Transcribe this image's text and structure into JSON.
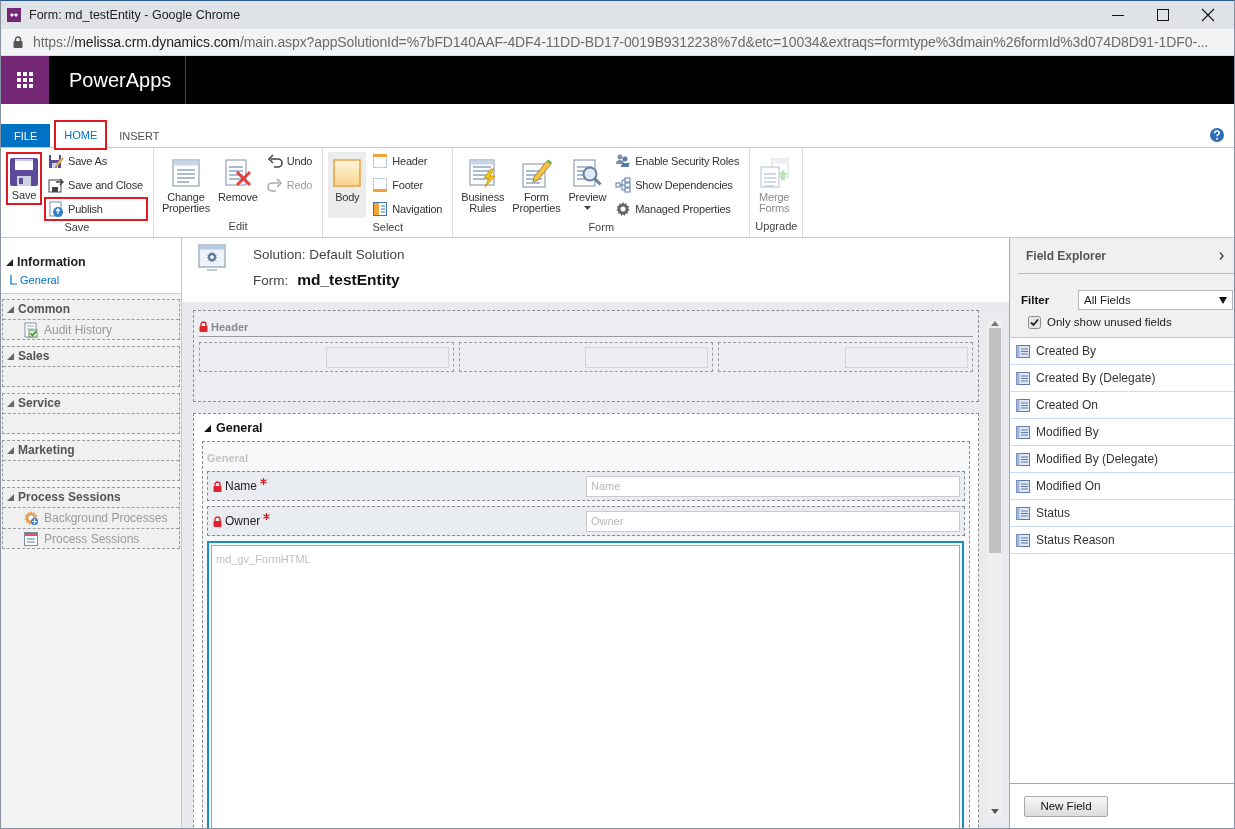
{
  "window": {
    "title": "Form: md_testEntity - Google Chrome"
  },
  "address_bar": {
    "scheme": "https://",
    "host": "melissa.crm.dynamics.com",
    "path": "/main.aspx?appSolutionId=%7bFD140AAF-4DF4-11DD-BD17-0019B9312238%7d&etc=10034&extraqs=formtype%3dmain%26formId%3d074D8D91-1DF0-..."
  },
  "app_bar": {
    "title": "PowerApps"
  },
  "ribbon": {
    "tabs": [
      {
        "label": "FILE",
        "kind": "file",
        "selected": false,
        "highlighted": false
      },
      {
        "label": "HOME",
        "kind": "tab",
        "selected": true,
        "highlighted": true
      },
      {
        "label": "INSERT",
        "kind": "tab",
        "selected": false,
        "highlighted": false
      }
    ],
    "groups": [
      {
        "label": "Save",
        "buttons": [
          {
            "label": "Save",
            "kind": "large",
            "highlighted": true,
            "disabled": false
          },
          {
            "label": "Save As",
            "kind": "small",
            "highlighted": false,
            "disabled": false
          },
          {
            "label": "Save and Close",
            "kind": "small",
            "highlighted": false,
            "disabled": false
          },
          {
            "label": "Publish",
            "kind": "small",
            "highlighted": true,
            "disabled": false
          }
        ]
      },
      {
        "label": "Edit",
        "buttons": [
          {
            "label": "Change Properties",
            "kind": "large",
            "highlighted": false,
            "disabled": false
          },
          {
            "label": "Remove",
            "kind": "large",
            "highlighted": false,
            "disabled": false
          },
          {
            "label": "Undo",
            "kind": "small",
            "highlighted": false,
            "disabled": false
          },
          {
            "label": "Redo",
            "kind": "small",
            "highlighted": false,
            "disabled": true
          }
        ]
      },
      {
        "label": "Select",
        "buttons": [
          {
            "label": "Body",
            "kind": "large",
            "highlighted": false,
            "disabled": false,
            "selected": true
          },
          {
            "label": "Header",
            "kind": "small",
            "highlighted": false,
            "disabled": false,
            "selected": false
          },
          {
            "label": "Footer",
            "kind": "small",
            "highlighted": false,
            "disabled": false,
            "selected": false
          },
          {
            "label": "Navigation",
            "kind": "small",
            "highlighted": false,
            "disabled": false,
            "selected": false
          }
        ]
      },
      {
        "label": "Form",
        "buttons": [
          {
            "label": "Business Rules",
            "kind": "large",
            "highlighted": false,
            "disabled": false
          },
          {
            "label": "Form Properties",
            "kind": "large",
            "highlighted": false,
            "disabled": false
          },
          {
            "label": "Preview",
            "kind": "dropdown",
            "highlighted": false,
            "disabled": false
          },
          {
            "label": "Enable Security Roles",
            "kind": "small",
            "highlighted": false,
            "disabled": false
          },
          {
            "label": "Show Dependencies",
            "kind": "small",
            "highlighted": false,
            "disabled": false
          },
          {
            "label": "Managed Properties",
            "kind": "small",
            "highlighted": false,
            "disabled": false
          }
        ]
      },
      {
        "label": "Upgrade",
        "buttons": [
          {
            "label": "Merge Forms",
            "kind": "large",
            "highlighted": false,
            "disabled": true
          }
        ]
      }
    ]
  },
  "navigation": {
    "sections": [
      {
        "title": "Information",
        "kind": "main",
        "expanded": true,
        "items": [
          {
            "label": "General",
            "selected": true
          }
        ]
      },
      {
        "title": "Common",
        "kind": "group",
        "expanded": true,
        "items": [
          {
            "label": "Audit History",
            "selected": false
          }
        ]
      },
      {
        "title": "Sales",
        "kind": "group",
        "expanded": true
      },
      {
        "title": "Service",
        "kind": "group",
        "expanded": true
      },
      {
        "title": "Marketing",
        "kind": "group",
        "expanded": true
      },
      {
        "title": "Process Sessions",
        "kind": "group",
        "expanded": true,
        "items": [
          {
            "label": "Background Processes",
            "selected": false
          },
          {
            "label": "Process Sessions",
            "selected": false
          }
        ]
      }
    ]
  },
  "form_header": {
    "solution": "Solution: Default Solution",
    "form_label": "Form:",
    "form_name": "md_testEntity"
  },
  "canvas": {
    "header": {
      "title": "Header",
      "locked": true
    },
    "tab": {
      "title": "General",
      "expanded": true,
      "section": {
        "title": "General",
        "fields": [
          {
            "label": "Name",
            "placeholder": "Name",
            "locked": true,
            "required": true
          },
          {
            "label": "Owner",
            "placeholder": "Owner",
            "locked": true,
            "required": true
          }
        ],
        "web_resource": {
          "label": "md_gv_FormHTML",
          "selected": true
        }
      }
    }
  },
  "field_explorer": {
    "title": "Field Explorer",
    "filter_label": "Filter",
    "filter_value": "All Fields",
    "only_unused": {
      "label": "Only show unused fields",
      "checked": true
    },
    "fields": [
      "Created By",
      "Created By (Delegate)",
      "Created On",
      "Modified By",
      "Modified By (Delegate)",
      "Modified On",
      "Status",
      "Status Reason"
    ],
    "new_field_button": "New Field"
  }
}
